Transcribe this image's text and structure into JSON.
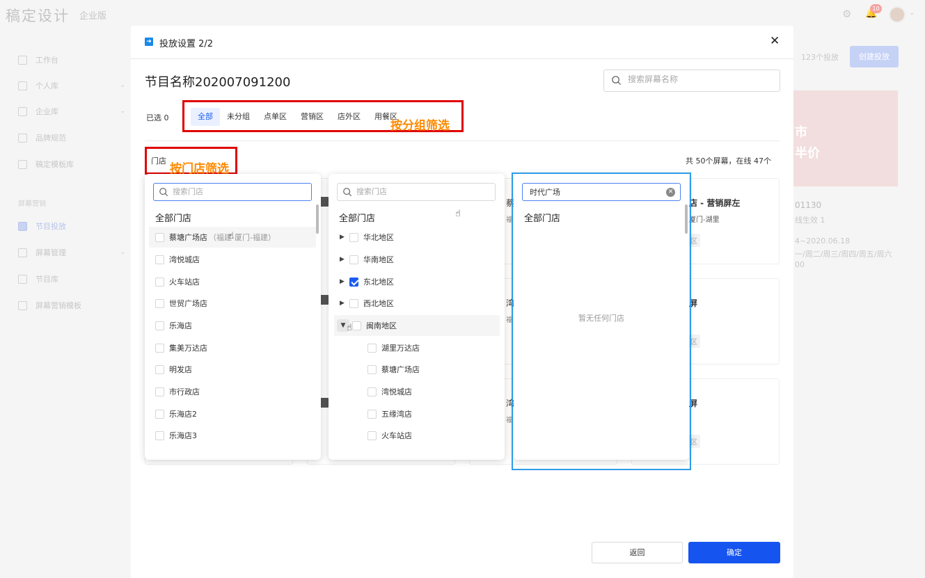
{
  "app": {
    "logo": "稿定设计",
    "edition": "企业版",
    "badge": "10",
    "sidebar": [
      {
        "label": "工作台"
      },
      {
        "label": "个人库"
      },
      {
        "label": "企业库"
      },
      {
        "label": "品牌规范"
      },
      {
        "label": "稿定模板库"
      },
      {
        "label": "节目投放"
      },
      {
        "label": "屏幕管理"
      },
      {
        "label": "节目库"
      },
      {
        "label": "屏幕营销模板"
      }
    ],
    "sidebar_group": "屏幕营销",
    "right": {
      "count": "123个投放",
      "create_button": "创建投放",
      "thumb_text_1": "市",
      "thumb_text_2": "半价",
      "id_text": "01130",
      "line1": "线生效 1",
      "line2": "4~2020.06.18",
      "line3": "一/周二/周三/周四/周五/周六",
      "line4": "00"
    }
  },
  "modal": {
    "title": "投放设置 2/2",
    "program_name": "节目名称202007091200",
    "search_screen_placeholder": "搜索屏幕名称",
    "selected_label": "已选 0",
    "group_tabs": [
      "全部",
      "未分组",
      "点单区",
      "营销区",
      "店外区",
      "用餐区"
    ],
    "annotation_group": "按分组筛选",
    "store_label": "门店",
    "annotation_store": "按门店筛选",
    "total_info": "共 50个屏幕，在线 47个",
    "cards": {
      "c1_title_a": "蔡",
      "c1_sub_a": "福",
      "c1_title_b": "店 - 营销屏左",
      "c1_sub_b": "厦门-湖里",
      "tag": "区",
      "c2_title_a": "湾",
      "c2_sub_a": "福",
      "c2_title_b": "屏",
      "c3_title_a": "湾",
      "c3_sub_a": "福",
      "c3_title_b": "屏"
    },
    "panel1": {
      "search_placeholder": "搜索门店",
      "all_label": "全部门店",
      "items": [
        {
          "name": "蔡塘广场店",
          "extra": "（福建-厦门-福建）"
        },
        {
          "name": "湾悦城店"
        },
        {
          "name": "火车站店"
        },
        {
          "name": "世贸广场店"
        },
        {
          "name": "乐海店"
        },
        {
          "name": "集美万达店"
        },
        {
          "name": "明发店"
        },
        {
          "name": "市行政店"
        },
        {
          "name": "乐海店2"
        },
        {
          "name": "乐海店3"
        }
      ]
    },
    "panel2": {
      "search_placeholder": "搜索门店",
      "all_label": "全部门店",
      "regions": [
        {
          "name": "华北地区",
          "checked": false
        },
        {
          "name": "华南地区",
          "checked": false
        },
        {
          "name": "东北地区",
          "checked": true
        },
        {
          "name": "西北地区",
          "checked": false
        },
        {
          "name": "闽南地区",
          "checked": false
        }
      ],
      "sub_items": [
        "湖里万达店",
        "蔡塘广场店",
        "湾悦城店",
        "五缘湾店",
        "火车站店"
      ]
    },
    "panel3": {
      "search_value": "时代广场",
      "all_label": "全部门店",
      "empty_text": "暂无任何门店"
    },
    "back_button": "返回",
    "ok_button": "确定"
  },
  "colors": {
    "primary": "#1654f0",
    "annotation_red": "#e00000",
    "annotation_orange": "#ff8a00",
    "annotation_blue": "#2f9be8"
  }
}
